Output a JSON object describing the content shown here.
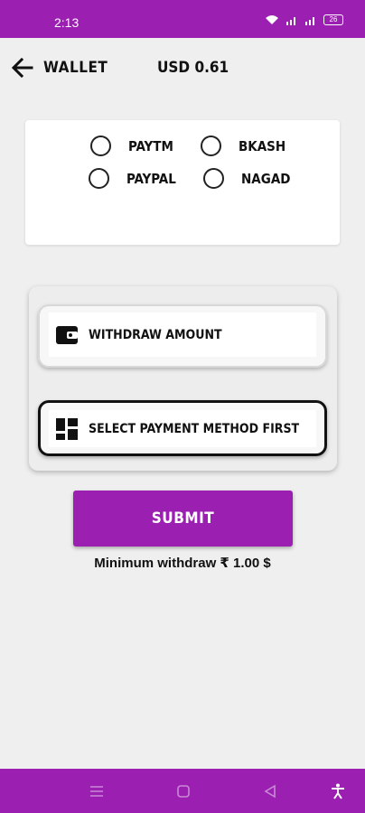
{
  "status_bar": {
    "time": "2:13",
    "battery": "26",
    "icons": [
      "wifi-icon",
      "signal-icon",
      "signal-icon",
      "battery-icon"
    ]
  },
  "header": {
    "title": "WALLET",
    "balance": "USD 0.61",
    "back_icon": "arrow-left-icon"
  },
  "payment_methods": {
    "options": [
      {
        "label": "PAYTM",
        "selected": false
      },
      {
        "label": "BKASH",
        "selected": false
      },
      {
        "label": "PAYPAL",
        "selected": false
      },
      {
        "label": "NAGAD",
        "selected": false
      }
    ]
  },
  "form": {
    "amount_placeholder": "WITHDRAW AMOUNT",
    "amount_icon": "wallet-icon",
    "method_placeholder": "SELECT PAYMENT METHOD FIRST",
    "method_icon": "dashboard-icon"
  },
  "submit": {
    "label": "SUBMIT"
  },
  "min_withdraw": "Minimum withdraw ₹ 1.00 $",
  "colors": {
    "accent": "#9b1fb0",
    "background": "#efefef"
  },
  "nav_bar": {
    "icons": [
      "menu-icon",
      "home-icon",
      "back-triangle-icon",
      "accessibility-icon"
    ]
  }
}
